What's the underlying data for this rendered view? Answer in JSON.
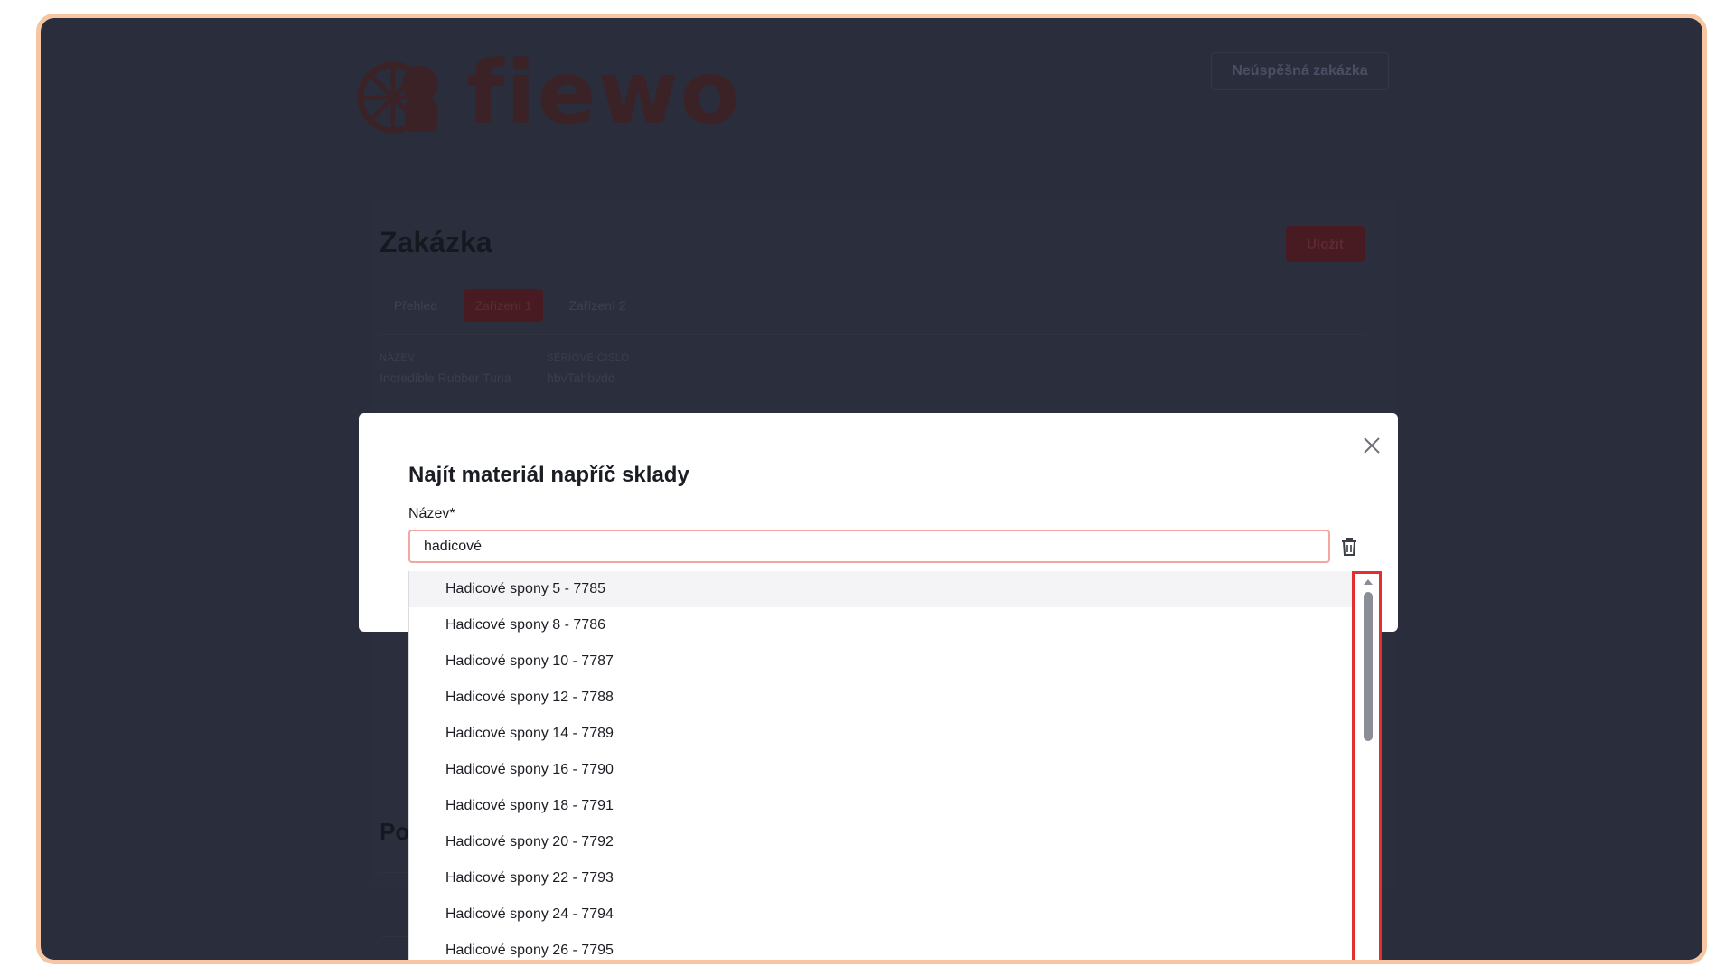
{
  "background_page": {
    "logo_text": "fiewo",
    "fail_button": "Neúspěšná zakázka",
    "title": "Zakázka",
    "save_button": "Uložit",
    "tabs": [
      "Přehled",
      "Zařízení 1",
      "Zařízení 2"
    ],
    "active_tab": "Zařízení 1",
    "meta": [
      {
        "label": "NÁZEV",
        "value": "Incredible Rubber Tuna"
      },
      {
        "label": "SÉRIOVÉ ČÍSLO",
        "value": "hbvTahbvdo"
      }
    ],
    "bottom_heading": "Po"
  },
  "modal": {
    "title": "Najít materiál napříč sklady",
    "field_label": "Název*",
    "search_value": "hadicové",
    "close_icon": "close-icon",
    "trash_icon": "trash-icon"
  },
  "dropdown": {
    "items": [
      "Hadicové spony 5 - 7785",
      "Hadicové spony 8 - 7786",
      "Hadicové spony 10 - 7787",
      "Hadicové spony 12 - 7788",
      "Hadicové spony 14 - 7789",
      "Hadicové spony 16 - 7790",
      "Hadicové spony 18 - 7791",
      "Hadicové spony 20 - 7792",
      "Hadicové spony 22 - 7793",
      "Hadicové spony 24 - 7794",
      "Hadicové spony 26 - 7795"
    ],
    "highlighted_index": 0
  },
  "colors": {
    "overlay": "#2a2e3c",
    "brand_dark": "#471b21",
    "input_focus": "#f2a8a0",
    "scrollbar_highlight": "#e03030",
    "frame": "#f6c6a3"
  }
}
